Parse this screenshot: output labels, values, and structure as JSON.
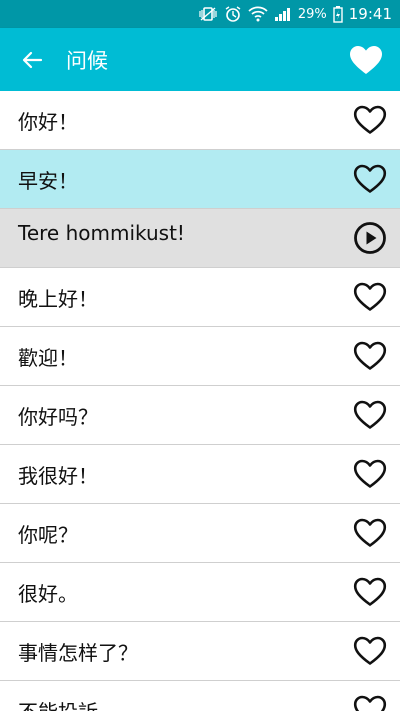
{
  "status_bar": {
    "battery": "29%",
    "time": "19:41"
  },
  "app_bar": {
    "title": "问候"
  },
  "items": [
    {
      "text": "你好！",
      "state": "normal",
      "icon": "heart-outline-icon"
    },
    {
      "text": "早安！",
      "state": "highlight",
      "icon": "heart-outline-icon"
    },
    {
      "text": "Tere hommikust!",
      "state": "expanded",
      "icon": "play-circle-icon"
    },
    {
      "text": "晚上好！",
      "state": "normal",
      "icon": "heart-outline-icon"
    },
    {
      "text": "歡迎！",
      "state": "normal",
      "icon": "heart-outline-icon"
    },
    {
      "text": "你好吗？",
      "state": "normal",
      "icon": "heart-outline-icon"
    },
    {
      "text": "我很好！",
      "state": "normal",
      "icon": "heart-outline-icon"
    },
    {
      "text": "你呢？",
      "state": "normal",
      "icon": "heart-outline-icon"
    },
    {
      "text": "很好。",
      "state": "normal",
      "icon": "heart-outline-icon"
    },
    {
      "text": "事情怎样了？",
      "state": "normal",
      "icon": "heart-outline-icon"
    },
    {
      "text": "不能投訴",
      "state": "normal",
      "icon": "heart-outline-icon"
    }
  ],
  "colors": {
    "status_bar": "#0097a7",
    "app_bar": "#00bcd4",
    "highlight_row": "#b2ebf2",
    "expanded_row": "#e0e0e0"
  }
}
